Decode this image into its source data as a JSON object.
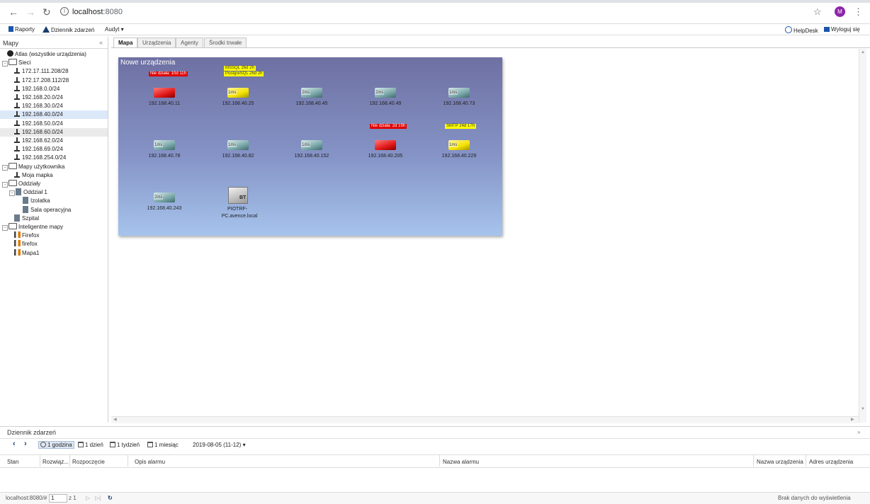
{
  "browser": {
    "url_host": "localhost",
    "url_port": ":8080",
    "avatar_letter": "M"
  },
  "toolbar": {
    "reports": "Raporty",
    "event_log": "Dziennik zdarzeń",
    "audit": "Audyt ▾",
    "helpdesk": "HelpDesk",
    "logout": "Wyloguj się"
  },
  "sidebar": {
    "title": "Mapy",
    "collapse": "«",
    "items": [
      {
        "label": "Atlas (wszystkie urządzenia)",
        "icon": "globe-icon",
        "level": 0
      },
      {
        "label": "Sieci",
        "icon": "folder-icon",
        "level": 0,
        "toggle": "⊟"
      },
      {
        "label": "172.17.111.208/28",
        "icon": "network-icon",
        "level": 1
      },
      {
        "label": "172.17.208.112/28",
        "icon": "network-icon",
        "level": 1
      },
      {
        "label": "192.168.0.0/24",
        "icon": "network-icon",
        "level": 1
      },
      {
        "label": "192.168.20.0/24",
        "icon": "network-icon",
        "level": 1
      },
      {
        "label": "192.168.30.0/24",
        "icon": "network-icon",
        "level": 1
      },
      {
        "label": "192.168.40.0/24",
        "icon": "network-icon",
        "level": 1,
        "selected": true
      },
      {
        "label": "192.168.50.0/24",
        "icon": "network-icon",
        "level": 1
      },
      {
        "label": "192.168.60.0/24",
        "icon": "network-icon",
        "level": 1,
        "hover": true
      },
      {
        "label": "192.168.62.0/24",
        "icon": "network-icon",
        "level": 1
      },
      {
        "label": "192.168.69.0/24",
        "icon": "network-icon",
        "level": 1
      },
      {
        "label": "192.168.254.0/24",
        "icon": "network-icon",
        "level": 1
      },
      {
        "label": "Mapy użytkownika",
        "icon": "folder-icon",
        "level": 0,
        "toggle": "⊟"
      },
      {
        "label": "Moja mapka",
        "icon": "network-icon",
        "level": 1
      },
      {
        "label": "Oddziały",
        "icon": "folder-icon",
        "level": 0,
        "toggle": "⊟"
      },
      {
        "label": "Oddział 1",
        "icon": "building-icon",
        "level": 1,
        "toggle": "⊟"
      },
      {
        "label": "Izolatka",
        "icon": "building-icon",
        "level": 2
      },
      {
        "label": "Sala operacyjna",
        "icon": "building-icon",
        "level": 2
      },
      {
        "label": "Szpital",
        "icon": "building-icon",
        "level": 1
      },
      {
        "label": "Inteligentne mapy",
        "icon": "folder-icon",
        "level": 0,
        "toggle": "⊟"
      },
      {
        "label": "Firefox",
        "icon": "smart-map-icon",
        "level": 1
      },
      {
        "label": "firefox",
        "icon": "smart-map-icon",
        "level": 1
      },
      {
        "label": "Mapa1",
        "icon": "smart-map-icon",
        "level": 1
      }
    ]
  },
  "tabs": [
    {
      "label": "Mapa",
      "active": true
    },
    {
      "label": "Urządzenia"
    },
    {
      "label": "Agenty"
    },
    {
      "label": "Środki trwałe"
    }
  ],
  "map": {
    "title": "Nowe urządzenia",
    "devices": [
      {
        "ip": "192.168.40.11",
        "color": "red",
        "alerts": [
          "Nie działa: 10d 11h"
        ],
        "alert_color": "red"
      },
      {
        "ip": "192.168.40.25",
        "color": "yellow",
        "ms": "1ms",
        "alerts": [
          "MSSQL 26d 2h",
          "PostgreSQL 26d 2h"
        ],
        "alert_color": "yellow"
      },
      {
        "ip": "192.168.40.45",
        "color": "gray",
        "ms": "2ms"
      },
      {
        "ip": "192.168.40.49",
        "color": "gray",
        "ms": "2ms"
      },
      {
        "ip": "192.168.40.73",
        "color": "gray",
        "ms": "1ms"
      },
      {
        "ip": "192.168.40.78",
        "color": "gray",
        "ms": "1ms"
      },
      {
        "ip": "192.168.40.82",
        "color": "gray",
        "ms": "1ms"
      },
      {
        "ip": "192.168.40.152",
        "color": "gray",
        "ms": "1ms"
      },
      {
        "ip": "192.168.40.205",
        "color": "red",
        "alerts": [
          "Nie działa: 2d 19h"
        ],
        "alert_color": "red"
      },
      {
        "ip": "192.168.40.229",
        "color": "yellow",
        "ms": "1ms",
        "alerts": [
          "SMTP 24d 17h"
        ],
        "alert_color": "yellow"
      },
      {
        "ip": "192.168.40.243",
        "color": "gray",
        "ms": "2ms"
      }
    ],
    "pc": {
      "name_line1": "PIOTRF-",
      "name_line2": "PC.avence.local",
      "badge": "BT"
    }
  },
  "eventlog": {
    "title": "Dziennik zdarzeń",
    "collapse": "»",
    "ranges": [
      "1 godzina",
      "1 dzień",
      "1 tydzień",
      "1 miesiąc"
    ],
    "date": "2019-08-05 (11-12) ▾",
    "columns": [
      "Stan",
      "Rozwiąz...",
      "Rozpoczęcie",
      "Opis alarmu",
      "Nazwa alarmu",
      "Nazwa urządzenia",
      "Adres urządzenia"
    ]
  },
  "statusbar": {
    "link": "localhost:8080/#",
    "page": "1",
    "of": "z 1",
    "no_data": "Brak danych do wyświetlenia"
  }
}
